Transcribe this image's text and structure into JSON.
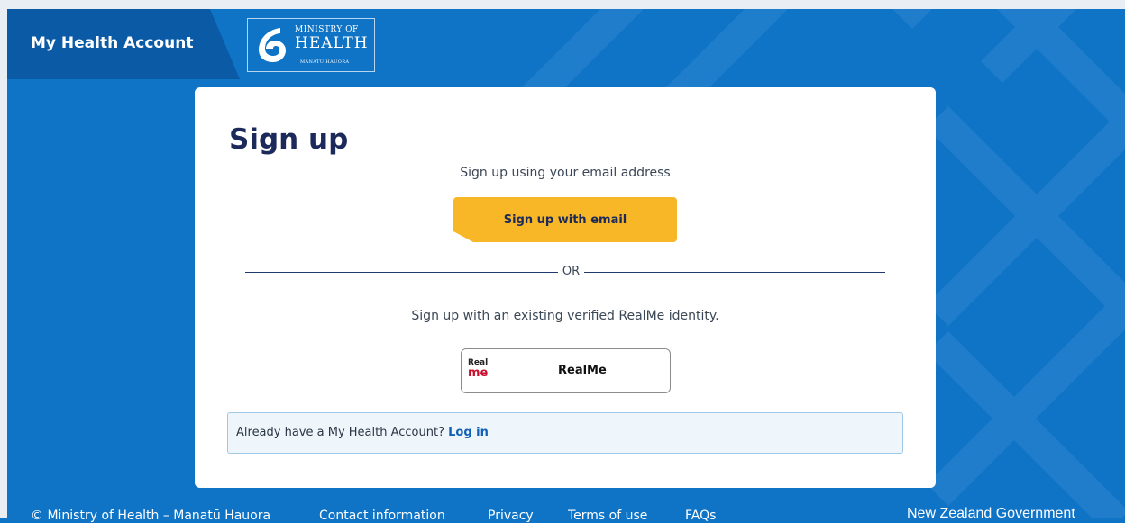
{
  "header": {
    "app_title": "My Health Account",
    "logo": {
      "line1": "MINISTRY OF",
      "line2": "HEALTH",
      "line3": "MANATŪ HAUORA"
    }
  },
  "card": {
    "title": "Sign up",
    "email_prompt": "Sign up using your email address",
    "email_button": "Sign up with email",
    "divider_text": "OR",
    "realme_prompt": "Sign up with an existing verified RealMe identity.",
    "realme_logo_top": "Real",
    "realme_logo_bottom": "me",
    "realme_button": "RealMe",
    "login_prompt": "Already have a My Health Account?",
    "login_link": "Log in"
  },
  "footer": {
    "copyright": "© Ministry of Health – Manatū Hauora",
    "links": [
      "Contact information",
      "Privacy",
      "Terms of use",
      "FAQs"
    ],
    "govt": "New Zealand Government"
  },
  "colors": {
    "background": "#0f73c6",
    "brand_tab": "#0a5aa6",
    "accent_button": "#f7b727",
    "title": "#1b2a5a",
    "link": "#1260b5"
  }
}
